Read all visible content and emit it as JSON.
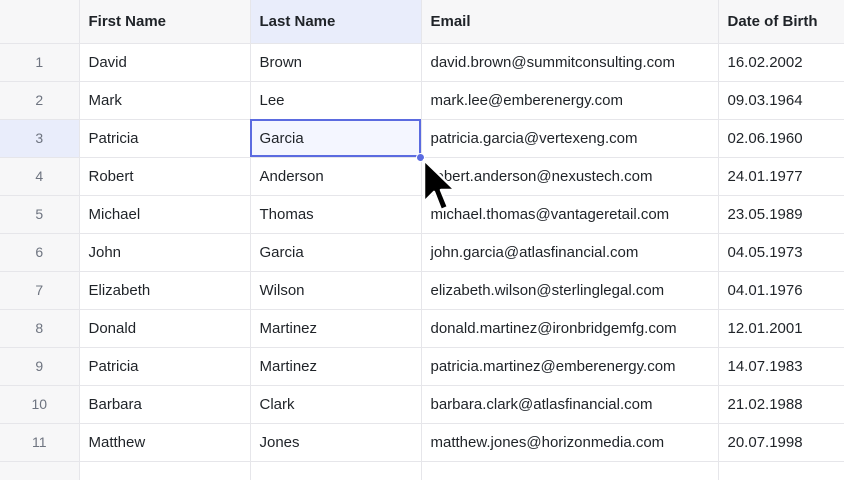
{
  "columns": {
    "first_name": "First Name",
    "last_name": "Last Name",
    "email": "Email",
    "dob": "Date of Birth"
  },
  "rows": [
    {
      "index": "1",
      "first": "David",
      "last": "Brown",
      "email": "david.brown@summitconsulting.com",
      "dob": "16.02.2002"
    },
    {
      "index": "2",
      "first": "Mark",
      "last": "Lee",
      "email": "mark.lee@emberenergy.com",
      "dob": "09.03.1964"
    },
    {
      "index": "3",
      "first": "Patricia",
      "last": "Garcia",
      "email": "patricia.garcia@vertexeng.com",
      "dob": "02.06.1960"
    },
    {
      "index": "4",
      "first": "Robert",
      "last": "Anderson",
      "email": "robert.anderson@nexustech.com",
      "dob": "24.01.1977"
    },
    {
      "index": "5",
      "first": "Michael",
      "last": "Thomas",
      "email": "michael.thomas@vantageretail.com",
      "dob": "23.05.1989"
    },
    {
      "index": "6",
      "first": "John",
      "last": "Garcia",
      "email": "john.garcia@atlasfinancial.com",
      "dob": "04.05.1973"
    },
    {
      "index": "7",
      "first": "Elizabeth",
      "last": "Wilson",
      "email": "elizabeth.wilson@sterlinglegal.com",
      "dob": "04.01.1976"
    },
    {
      "index": "8",
      "first": "Donald",
      "last": "Martinez",
      "email": "donald.martinez@ironbridgemfg.com",
      "dob": "12.01.2001"
    },
    {
      "index": "9",
      "first": "Patricia",
      "last": "Martinez",
      "email": "patricia.martinez@emberenergy.com",
      "dob": "14.07.1983"
    },
    {
      "index": "10",
      "first": "Barbara",
      "last": "Clark",
      "email": "barbara.clark@atlasfinancial.com",
      "dob": "21.02.1988"
    },
    {
      "index": "11",
      "first": "Matthew",
      "last": "Jones",
      "email": "matthew.jones@horizonmedia.com",
      "dob": "20.07.1998"
    },
    {
      "index": "",
      "first": "",
      "last": "",
      "email": "",
      "dob": ""
    }
  ],
  "selection": {
    "row": 3,
    "column": "last_name"
  },
  "colors": {
    "accent": "#5b6be0",
    "header_bg": "#f7f7f8",
    "active_header_bg": "#e9edfb"
  },
  "cursor_icon": "arrow-pointer-icon"
}
